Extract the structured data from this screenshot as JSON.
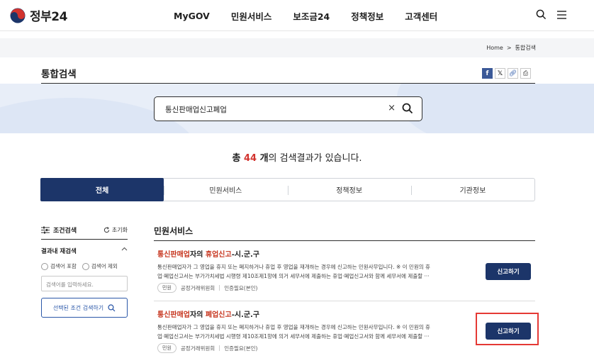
{
  "header": {
    "logo_text": "정부24",
    "nav": [
      "MyGOV",
      "민원서비스",
      "보조금24",
      "정책정보",
      "고객센터"
    ]
  },
  "breadcrumb": {
    "home": "Home",
    "sep": ">",
    "current": "통합검색"
  },
  "page": {
    "title": "통합검색"
  },
  "share_icons": [
    "facebook-icon",
    "x-icon",
    "link-icon",
    "print-icon"
  ],
  "search": {
    "value": "통신판매업신고폐업",
    "clear": "×"
  },
  "result": {
    "prefix": "총 ",
    "count": "44",
    "unit": " 개",
    "suffix": "의 검색결과가 있습니다."
  },
  "tabs": [
    {
      "label": "전체",
      "active": true
    },
    {
      "label": "민원서비스",
      "active": false
    },
    {
      "label": "정책정보",
      "active": false
    },
    {
      "label": "기관정보",
      "active": false
    }
  ],
  "filter": {
    "title": "조건검색",
    "reset": "초기화",
    "refine_title": "결과내 재검색",
    "include_label": "검색어 포함",
    "exclude_label": "검색어 제외",
    "input_placeholder": "검색어를 입력하세요.",
    "apply_label": "선택된 조건 검색하기"
  },
  "section": {
    "title": "민원서비스"
  },
  "items": [
    {
      "title_hl1": "통신판매업",
      "title_mid": "자의 ",
      "title_hl2": "휴업신고",
      "title_end": "-시.군.구",
      "desc_line1": "통신판매업자가 그 영업을 휴지 또는 폐지하거나 휴업 후 영업을 재개하는 경우에 신고하는 민원사무입니다. ※ 이 민원의 휴",
      "desc_line2": "업·폐업신고서는 부가가치세법 시행령 제10조제1항에 의거 세무서에 제출하는 휴업·폐업신고서와 함께 세무서에 제출할 ···",
      "badge": "민원",
      "agency": "공정거래위원회",
      "auth": "인증필요(본인)",
      "button": "신고하기"
    },
    {
      "title_hl1": "통신판매업",
      "title_mid": "자의 ",
      "title_hl2": "폐업신고",
      "title_end": "-시.군.구",
      "desc_line1": "통신판매업자가 그 영업을 휴지 또는 폐지하거나 휴업 후 영업을 재개하는 경우에 신고하는 민원사무입니다. ※ 이 민원의 휴",
      "desc_line2": "업·폐업신고서는 부가가치세법 시행령 제10조제1항에 의거 세무서에 제출하는 휴업·폐업신고서와 함께 세무서에 제출할 ···",
      "badge": "민원",
      "agency": "공정거래위원회",
      "auth": "인증필요(본인)",
      "button": "신고하기"
    }
  ],
  "colors": {
    "navy": "#1c3569",
    "highlight_red": "#c7361f",
    "annotation_red": "#e53935"
  }
}
